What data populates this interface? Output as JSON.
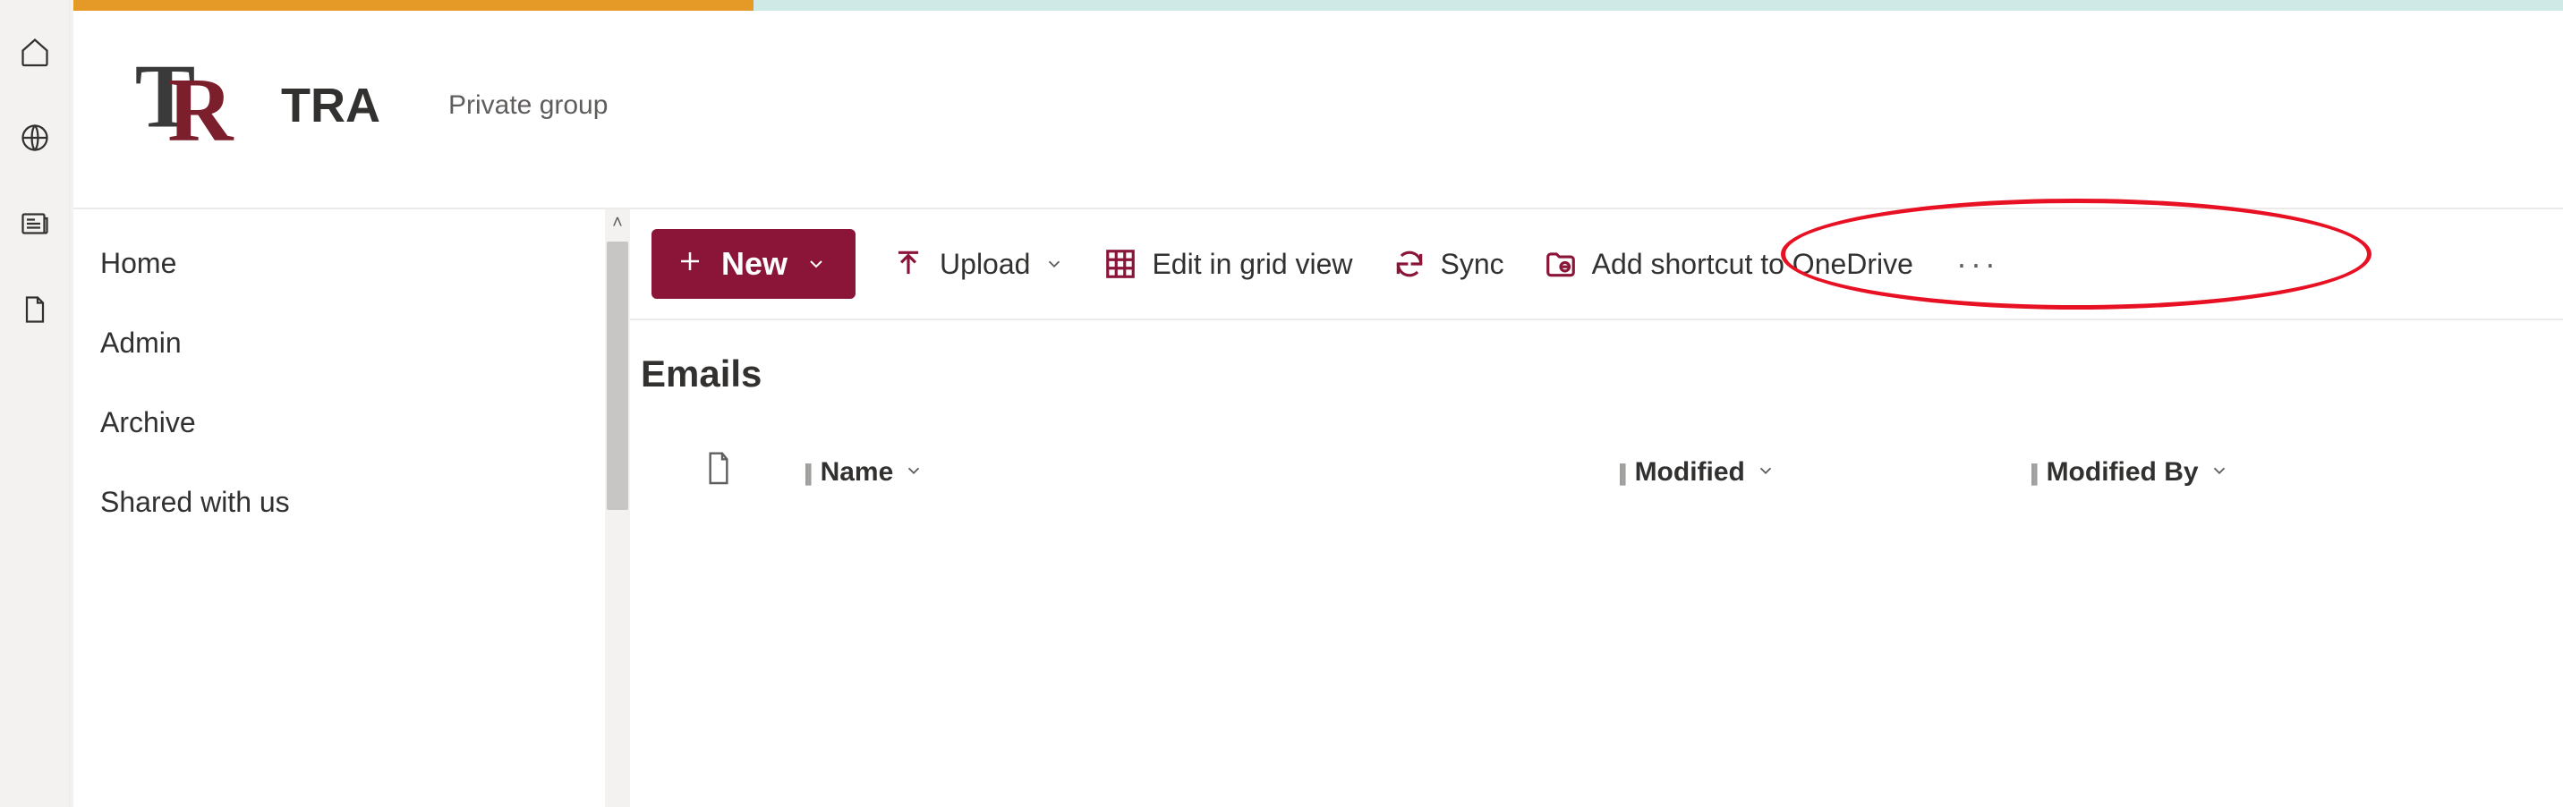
{
  "site": {
    "title": "TRA",
    "subtitle": "Private group"
  },
  "rail": {
    "items": [
      "home",
      "globe",
      "news",
      "file"
    ]
  },
  "nav": {
    "items": [
      {
        "label": "Home"
      },
      {
        "label": "Admin"
      },
      {
        "label": "Archive"
      },
      {
        "label": "Shared with us"
      }
    ]
  },
  "toolbar": {
    "new_label": "New",
    "upload_label": "Upload",
    "edit_grid_label": "Edit in grid view",
    "sync_label": "Sync",
    "add_shortcut_label": "Add shortcut to OneDrive",
    "more_label": "···"
  },
  "library": {
    "title": "Emails",
    "columns": {
      "name": "Name",
      "modified": "Modified",
      "modified_by": "Modified By"
    }
  },
  "colors": {
    "brand_primary": "#8a1538",
    "annotation": "#e81123"
  },
  "annotation": {
    "target": "add-shortcut-button"
  }
}
